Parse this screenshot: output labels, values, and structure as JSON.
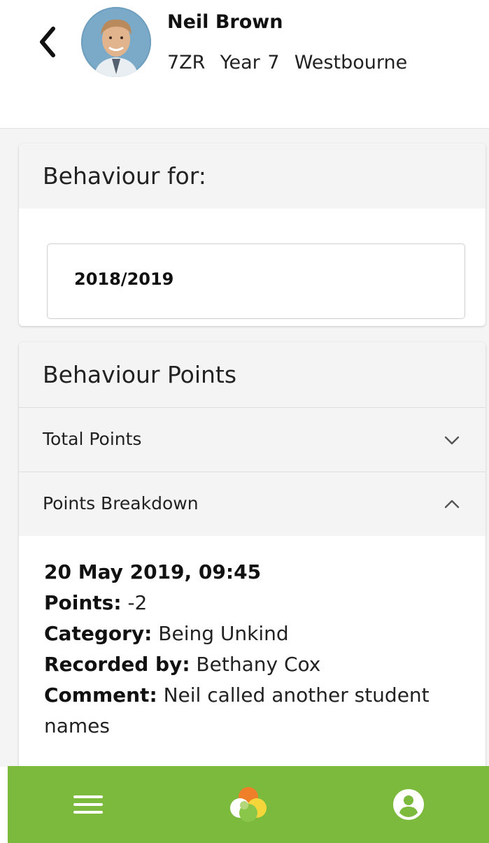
{
  "header": {
    "student_name": "Neil Brown",
    "student_meta": "7ZR  Year 7  Westbourne",
    "back_icon": "chevron-left-icon",
    "avatar": "student-photo"
  },
  "behaviour_for": {
    "title": "Behaviour for:",
    "selected_year": "2018/2019"
  },
  "behaviour_points": {
    "title": "Behaviour Points",
    "sections": [
      {
        "label": "Total Points",
        "expanded": false,
        "icon": "chevron-down-icon"
      },
      {
        "label": "Points Breakdown",
        "expanded": true,
        "icon": "chevron-up-icon"
      }
    ],
    "entry": {
      "datetime": "20 May 2019, 09:45",
      "points_label": "Points:",
      "points_value": "-2",
      "category_label": "Category:",
      "category_value": "Being Unkind",
      "recorded_label": "Recorded by:",
      "recorded_value": "Bethany Cox",
      "comment_label": "Comment:",
      "comment_value": "Neil called another student names"
    }
  },
  "bottom_nav": {
    "items": [
      {
        "icon": "hamburger-menu-icon"
      },
      {
        "icon": "app-logo-icon"
      },
      {
        "icon": "account-icon"
      }
    ],
    "color": "#7cba3d"
  }
}
